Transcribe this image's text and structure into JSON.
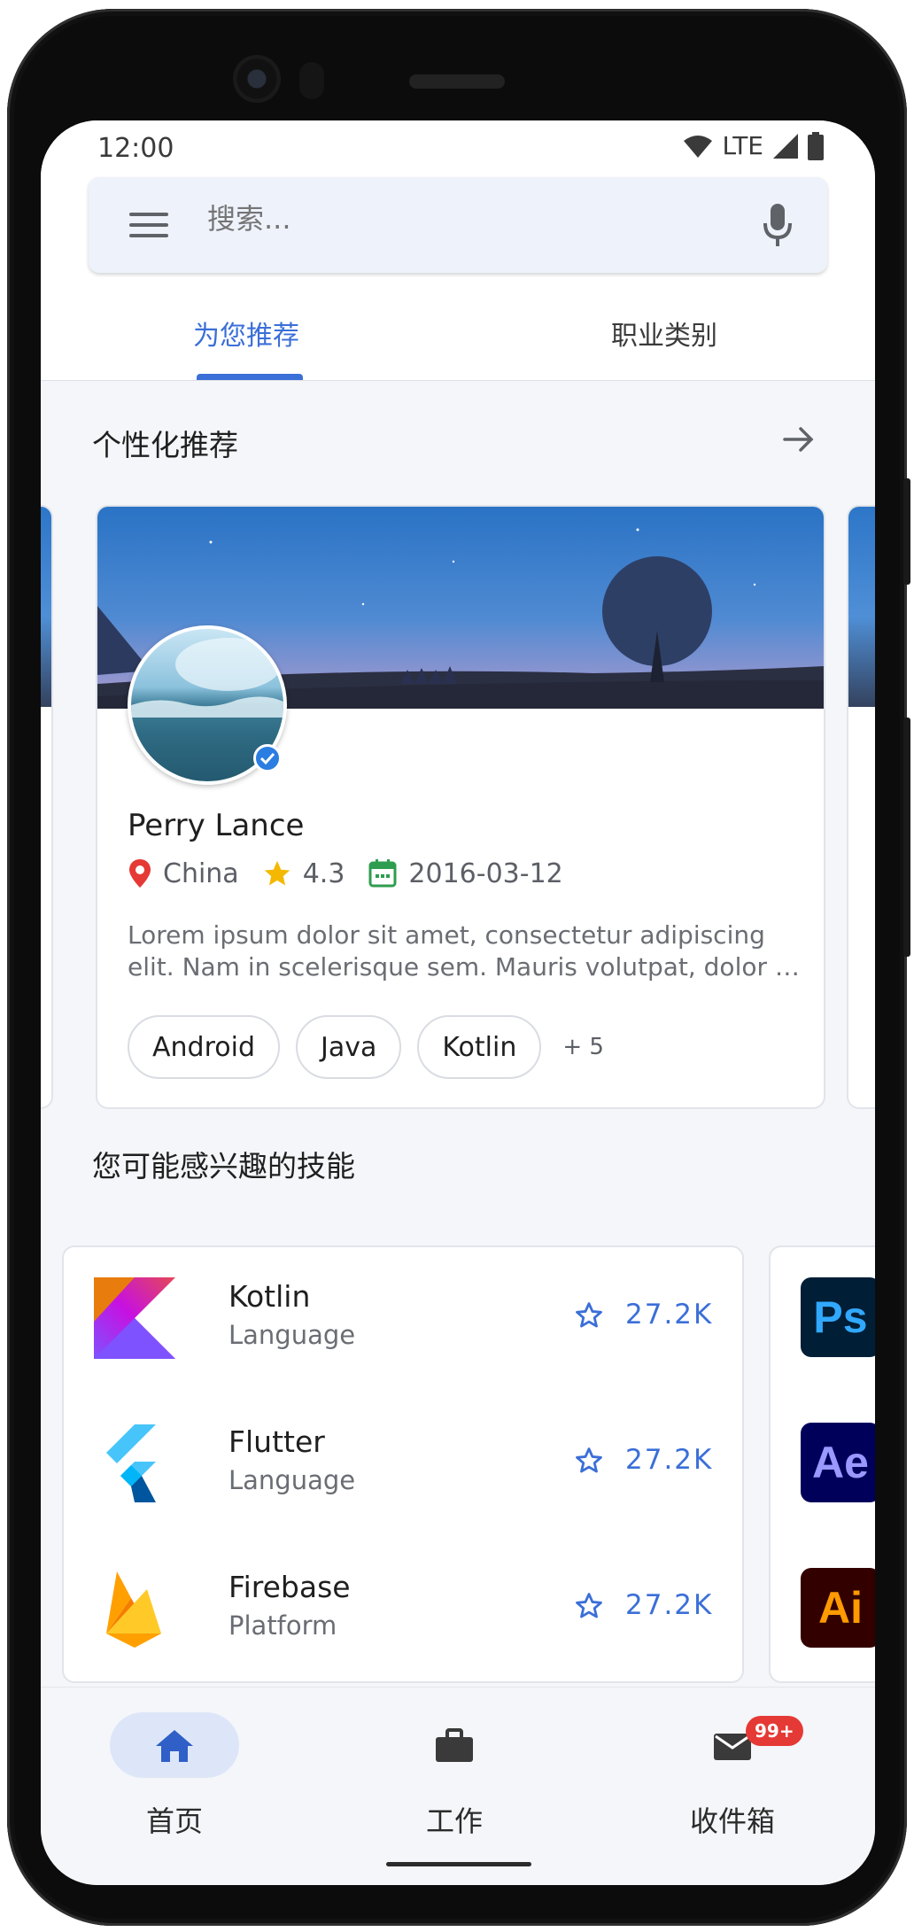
{
  "status_bar": {
    "time": "12:00",
    "network": "LTE"
  },
  "search": {
    "placeholder": "搜索..."
  },
  "tabs": [
    {
      "label": "为您推荐",
      "active": true
    },
    {
      "label": "职业类别",
      "active": false
    }
  ],
  "sections": {
    "personalized": "个性化推荐",
    "skills": "您可能感兴趣的技能"
  },
  "profile_card": {
    "name": "Perry Lance",
    "location": "China",
    "rating": "4.3",
    "date": "2016-03-12",
    "description": "Lorem ipsum dolor sit amet, consectetur adipiscing elit. Nam in scelerisque sem. Mauris volutpat, dolor id interdum ullamcorper, risus dolor egestas lectus.",
    "tags": [
      "Android",
      "Java",
      "Kotlin"
    ],
    "more_tags": "+ 5",
    "verified": true
  },
  "skills": [
    {
      "name": "Kotlin",
      "type": "Language",
      "stars": "27.2K",
      "icon": "kotlin-logo"
    },
    {
      "name": "Flutter",
      "type": "Language",
      "stars": "27.2K",
      "icon": "flutter-logo"
    },
    {
      "name": "Firebase",
      "type": "Platform",
      "stars": "27.2K",
      "icon": "firebase-logo"
    }
  ],
  "adobe_apps": [
    {
      "abbr": "Ps",
      "bg": "#001e36",
      "fg": "#31a8ff"
    },
    {
      "abbr": "Ae",
      "bg": "#00005b",
      "fg": "#9999ff"
    },
    {
      "abbr": "Ai",
      "bg": "#330000",
      "fg": "#ff9a00"
    }
  ],
  "bottom_nav": [
    {
      "label": "首页",
      "icon": "home-icon",
      "active": true
    },
    {
      "label": "工作",
      "icon": "briefcase-icon",
      "active": false
    },
    {
      "label": "收件箱",
      "icon": "mail-icon",
      "active": false,
      "badge": "99+"
    }
  ],
  "colors": {
    "accent": "#3b6fd8",
    "badge": "#e53935",
    "location_pin": "#e53935",
    "star": "#f5b800",
    "calendar": "#2e9d4f"
  }
}
